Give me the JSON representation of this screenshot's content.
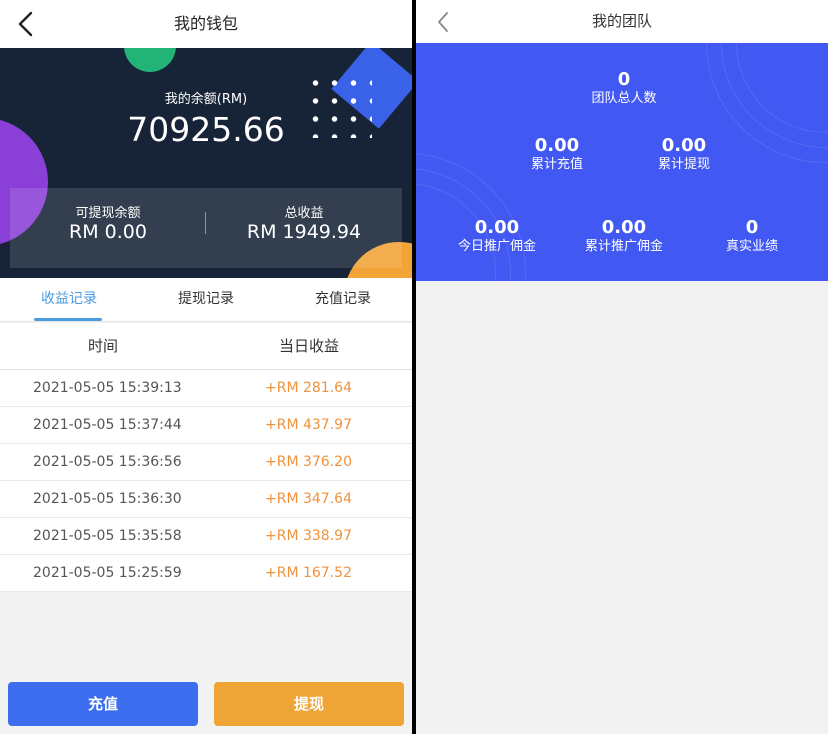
{
  "wallet": {
    "title": "我的钱包",
    "balance_label": "我的余额(RM)",
    "balance_value": "70925.66",
    "withdrawable_label": "可提现余额",
    "withdrawable_value": "RM 0.00",
    "total_income_label": "总收益",
    "total_income_value": "RM 1949.94",
    "tabs": [
      {
        "label": "收益记录",
        "active": true
      },
      {
        "label": "提现记录",
        "active": false
      },
      {
        "label": "充值记录",
        "active": false
      }
    ],
    "columns": {
      "time": "时间",
      "daily_income": "当日收益"
    },
    "records": [
      {
        "time": "2021-05-05 15:39:13",
        "amount": "+RM 281.64"
      },
      {
        "time": "2021-05-05 15:37:44",
        "amount": "+RM 437.97"
      },
      {
        "time": "2021-05-05 15:36:56",
        "amount": "+RM 376.20"
      },
      {
        "time": "2021-05-05 15:36:30",
        "amount": "+RM 347.64"
      },
      {
        "time": "2021-05-05 15:35:58",
        "amount": "+RM 338.97"
      },
      {
        "time": "2021-05-05 15:25:59",
        "amount": "+RM 167.52"
      }
    ],
    "recharge_label": "充值",
    "withdraw_label": "提现"
  },
  "team": {
    "title": "我的团队",
    "total_members": {
      "value": "0",
      "label": "团队总人数"
    },
    "cumulative_recharge": {
      "value": "0.00",
      "label": "累计充值"
    },
    "cumulative_withdraw": {
      "value": "0.00",
      "label": "累计提现"
    },
    "today_commission": {
      "value": "0.00",
      "label": "今日推广佣金"
    },
    "cumulative_commission": {
      "value": "0.00",
      "label": "累计推广佣金"
    },
    "real_performance": {
      "value": "0",
      "label": "真实业绩"
    }
  },
  "colors": {
    "wallet_card_bg": "#172437",
    "team_card_bg": "#4159f2",
    "accent_blue": "#4a9be0",
    "income_orange": "#f0923c",
    "recharge_button": "#3d6ef0",
    "withdraw_button": "#efa536"
  },
  "icons": {
    "back": "chevron-left-icon"
  }
}
